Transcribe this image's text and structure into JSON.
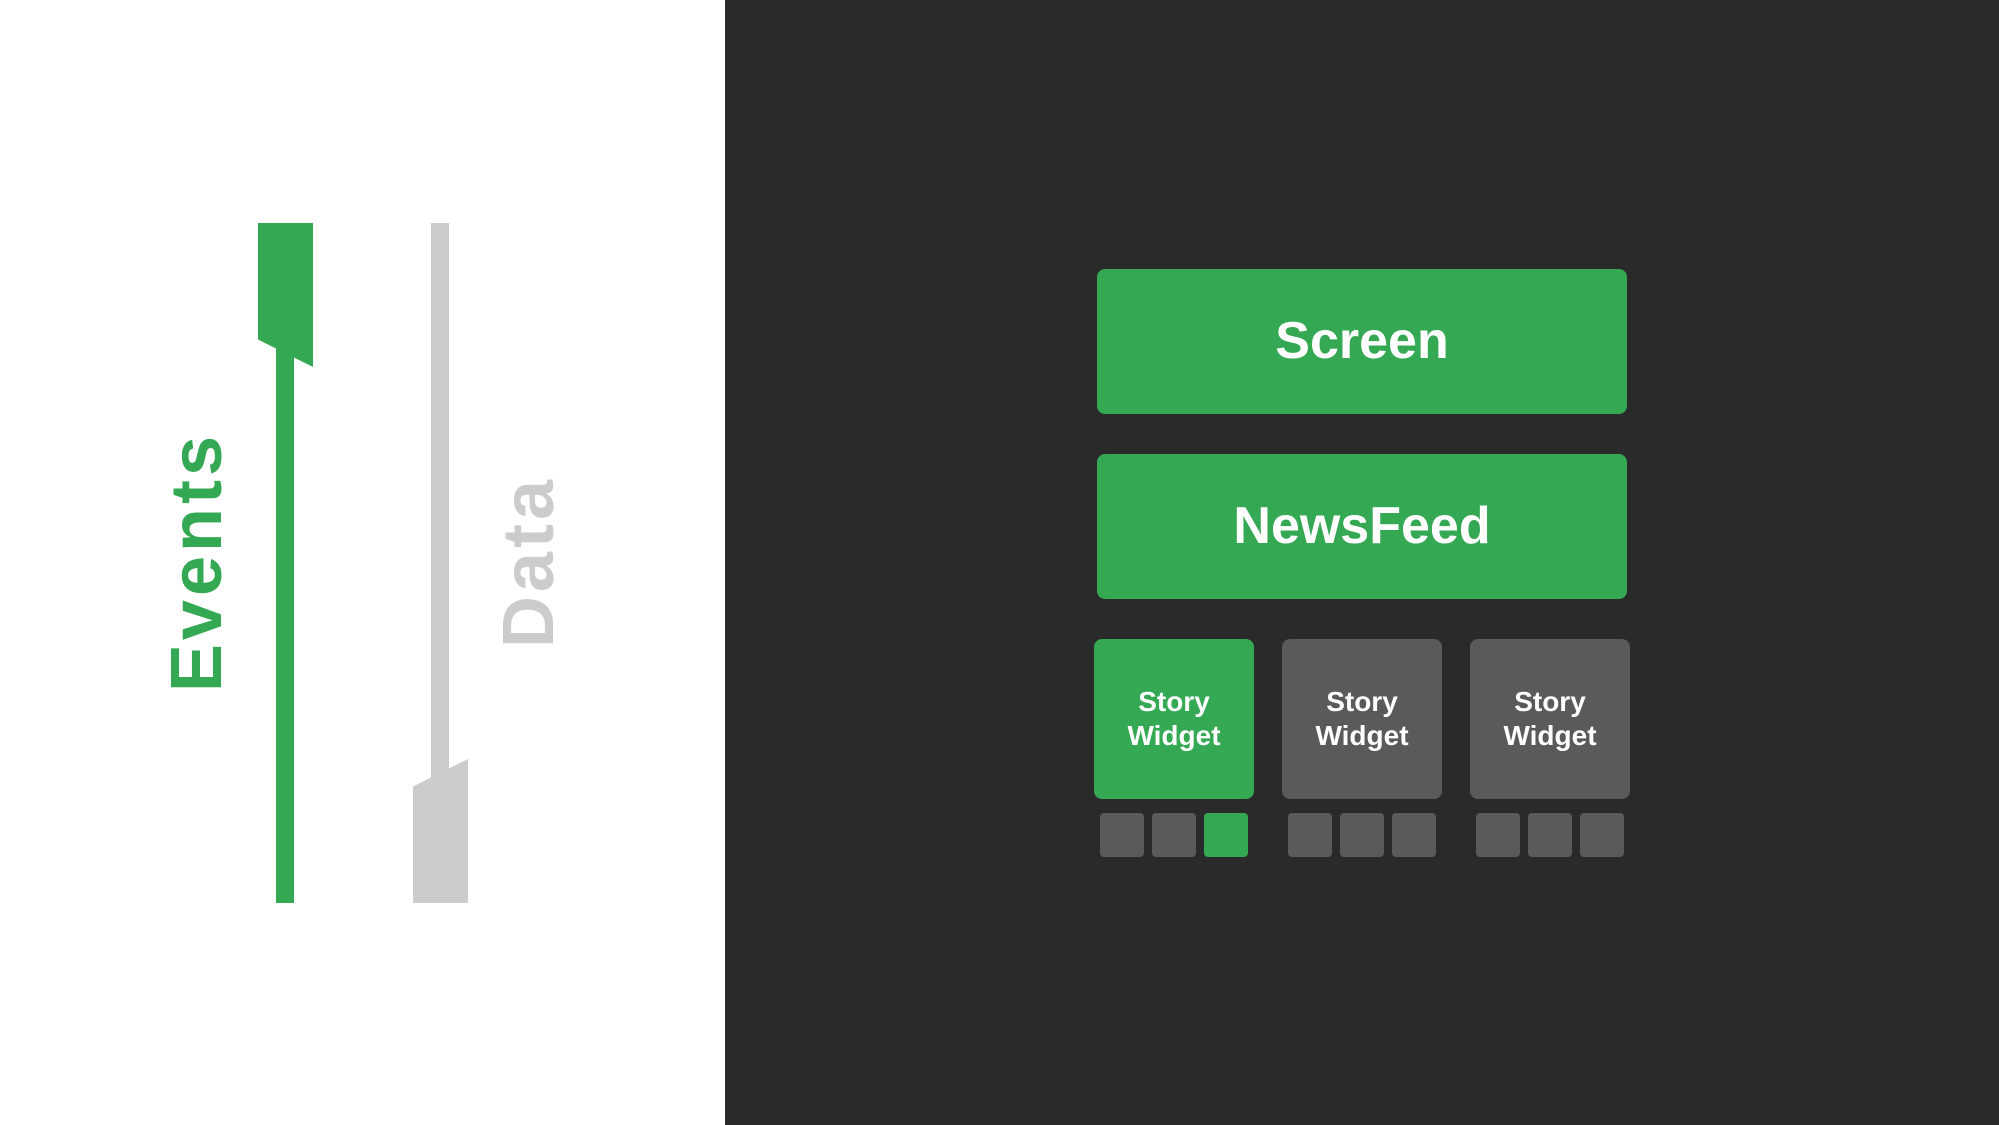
{
  "left": {
    "events_label": "Events",
    "data_label": "Data"
  },
  "right": {
    "screen_label": "Screen",
    "newsfeed_label": "NewsFeed",
    "story_widget_label": "Story\nWidget",
    "story_widget_1": "Story\nWidget",
    "story_widget_2": "Story\nWidget",
    "story_widget_3": "Story\nWidget"
  },
  "colors": {
    "green": "#34a853",
    "gray": "#5a5a5a",
    "dark_bg": "#2a2a2a",
    "white_bg": "#ffffff"
  }
}
